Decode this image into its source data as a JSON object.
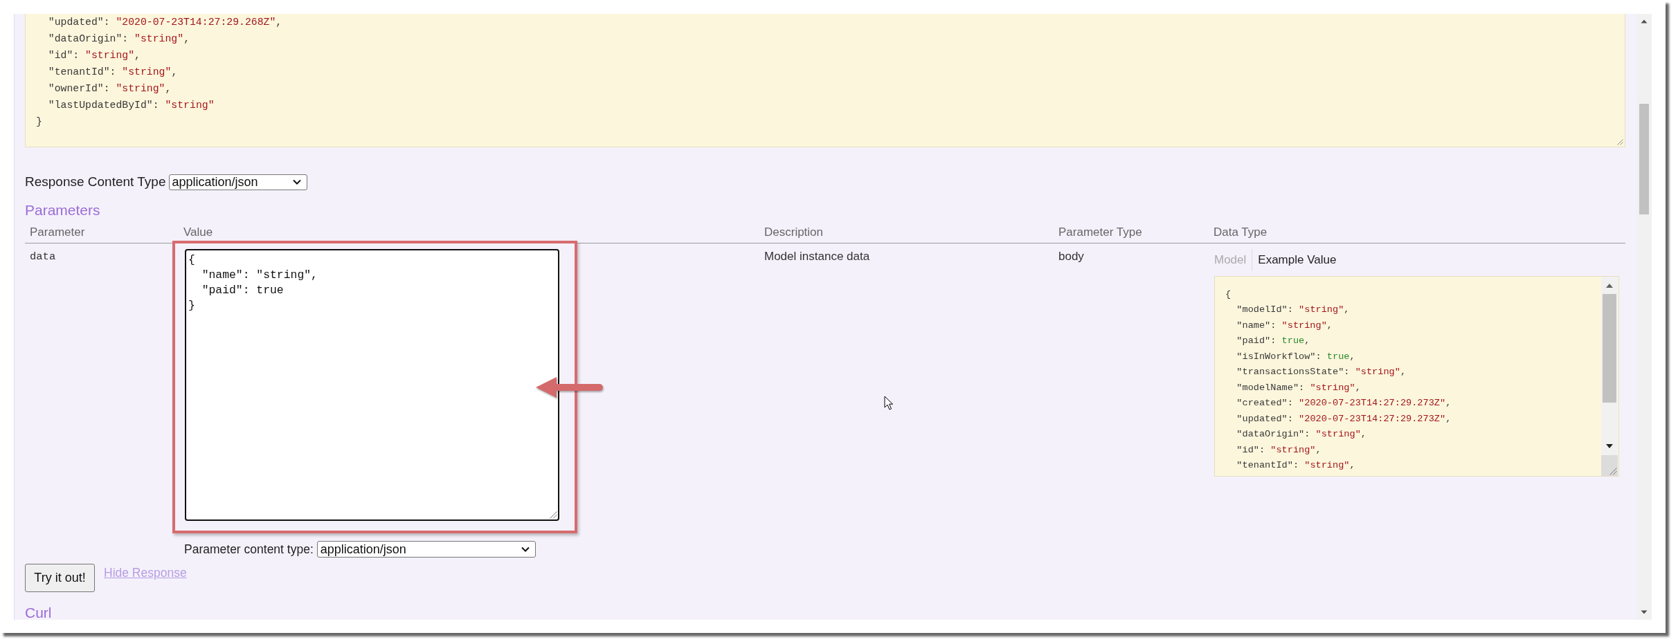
{
  "model_schema": {
    "lines": [
      [
        {
          "text": "  \"updated\": ",
          "kind": "plain"
        },
        {
          "text": "\"2020-07-23T14:27:29.268Z\"",
          "kind": "string"
        },
        {
          "text": ",",
          "kind": "plain"
        }
      ],
      [
        {
          "text": "  \"dataOrigin\": ",
          "kind": "plain"
        },
        {
          "text": "\"string\"",
          "kind": "string"
        },
        {
          "text": ",",
          "kind": "plain"
        }
      ],
      [
        {
          "text": "  \"id\": ",
          "kind": "plain"
        },
        {
          "text": "\"string\"",
          "kind": "string"
        },
        {
          "text": ",",
          "kind": "plain"
        }
      ],
      [
        {
          "text": "  \"tenantId\": ",
          "kind": "plain"
        },
        {
          "text": "\"string\"",
          "kind": "string"
        },
        {
          "text": ",",
          "kind": "plain"
        }
      ],
      [
        {
          "text": "  \"ownerId\": ",
          "kind": "plain"
        },
        {
          "text": "\"string\"",
          "kind": "string"
        },
        {
          "text": ",",
          "kind": "plain"
        }
      ],
      [
        {
          "text": "  \"lastUpdatedById\": ",
          "kind": "plain"
        },
        {
          "text": "\"string\"",
          "kind": "string"
        }
      ],
      [
        {
          "text": "}",
          "kind": "plain"
        }
      ]
    ]
  },
  "response_content_type": {
    "label": "Response Content Type",
    "value": "application/json"
  },
  "parameters": {
    "title": "Parameters",
    "columns": [
      "Parameter",
      "Value",
      "Description",
      "Parameter Type",
      "Data Type"
    ],
    "rows": [
      {
        "parameter": "data",
        "value": "{\n  \"name\": \"string\",\n  \"paid\": true\n}",
        "description": "Model instance data",
        "parameter_type": "body",
        "data_type": {
          "tabs": [
            {
              "label": "Model",
              "selected": false
            },
            {
              "label": "Example Value",
              "selected": true
            }
          ],
          "example_lines": [
            [
              {
                "text": "{",
                "kind": "plain"
              }
            ],
            [
              {
                "text": "  \"modelId\": ",
                "kind": "plain"
              },
              {
                "text": "\"string\"",
                "kind": "string"
              },
              {
                "text": ",",
                "kind": "plain"
              }
            ],
            [
              {
                "text": "  \"name\": ",
                "kind": "plain"
              },
              {
                "text": "\"string\"",
                "kind": "string"
              },
              {
                "text": ",",
                "kind": "plain"
              }
            ],
            [
              {
                "text": "  \"paid\": ",
                "kind": "plain"
              },
              {
                "text": "true",
                "kind": "boolean"
              },
              {
                "text": ",",
                "kind": "plain"
              }
            ],
            [
              {
                "text": "  \"isInWorkflow\": ",
                "kind": "plain"
              },
              {
                "text": "true",
                "kind": "boolean"
              },
              {
                "text": ",",
                "kind": "plain"
              }
            ],
            [
              {
                "text": "  \"transactionsState\": ",
                "kind": "plain"
              },
              {
                "text": "\"string\"",
                "kind": "string"
              },
              {
                "text": ",",
                "kind": "plain"
              }
            ],
            [
              {
                "text": "  \"modelName\": ",
                "kind": "plain"
              },
              {
                "text": "\"string\"",
                "kind": "string"
              },
              {
                "text": ",",
                "kind": "plain"
              }
            ],
            [
              {
                "text": "  \"created\": ",
                "kind": "plain"
              },
              {
                "text": "\"2020-07-23T14:27:29.273Z\"",
                "kind": "string"
              },
              {
                "text": ",",
                "kind": "plain"
              }
            ],
            [
              {
                "text": "  \"updated\": ",
                "kind": "plain"
              },
              {
                "text": "\"2020-07-23T14:27:29.273Z\"",
                "kind": "string"
              },
              {
                "text": ",",
                "kind": "plain"
              }
            ],
            [
              {
                "text": "  \"dataOrigin\": ",
                "kind": "plain"
              },
              {
                "text": "\"string\"",
                "kind": "string"
              },
              {
                "text": ",",
                "kind": "plain"
              }
            ],
            [
              {
                "text": "  \"id\": ",
                "kind": "plain"
              },
              {
                "text": "\"string\"",
                "kind": "string"
              },
              {
                "text": ",",
                "kind": "plain"
              }
            ],
            [
              {
                "text": "  \"tenantId\": ",
                "kind": "plain"
              },
              {
                "text": "\"string\"",
                "kind": "string"
              },
              {
                "text": ",",
                "kind": "plain"
              }
            ]
          ]
        },
        "content_type": {
          "label": "Parameter content type:",
          "value": "application/json"
        }
      }
    ]
  },
  "actions": {
    "try_button": "Try it out!",
    "hide_response_link": "Hide Response"
  },
  "curl": {
    "title": "Curl"
  }
}
